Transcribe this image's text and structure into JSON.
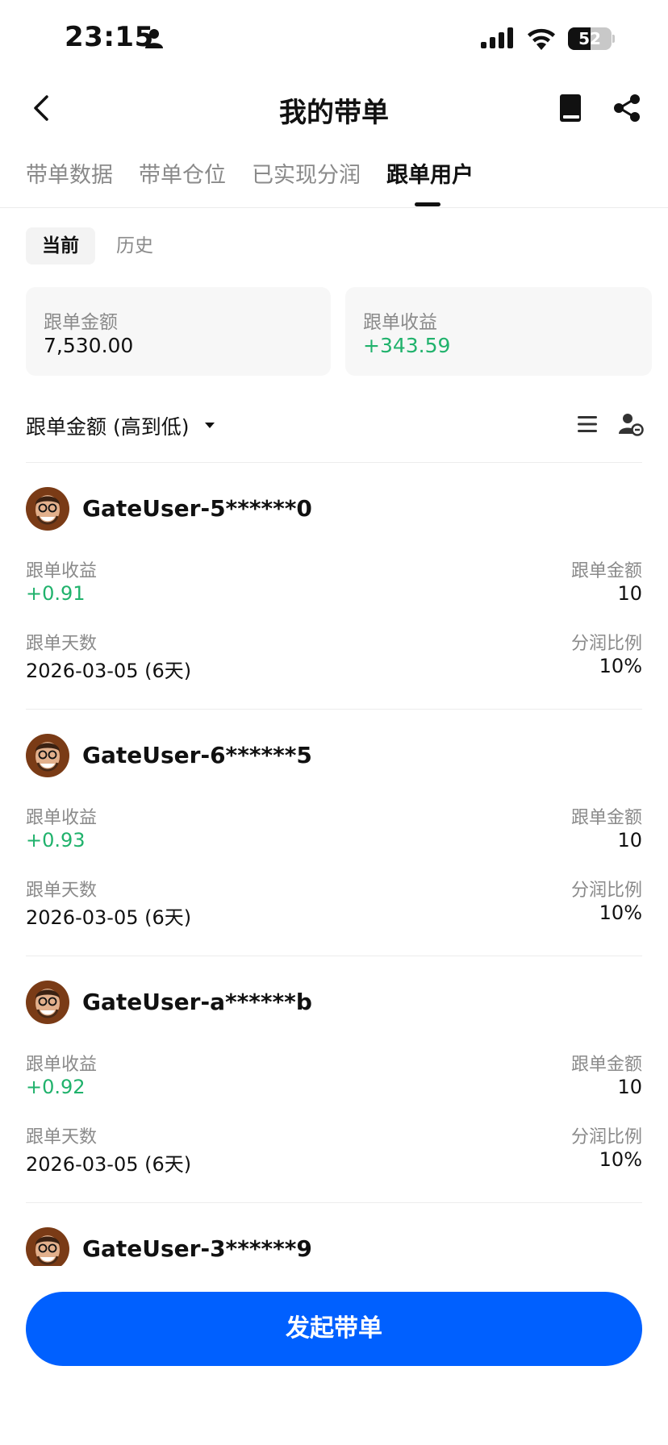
{
  "status_bar": {
    "time": "23:15",
    "battery_text": "52",
    "battery_level_percent": 52,
    "icons": [
      "person-icon",
      "signal-icon",
      "wifi-icon",
      "battery-icon"
    ]
  },
  "header": {
    "title": "我的带单",
    "icons": [
      "back-icon",
      "book-icon",
      "share-icon"
    ]
  },
  "tabs": [
    {
      "label": "带单数据",
      "active": false
    },
    {
      "label": "带单仓位",
      "active": false
    },
    {
      "label": "已实现分润",
      "active": false
    },
    {
      "label": "跟单用户",
      "active": true
    }
  ],
  "subtabs": {
    "current": "当前",
    "history": "历史",
    "selected": "当前"
  },
  "summary": {
    "amount_label": "跟单金额",
    "amount_value": "7,530.00",
    "profit_label": "跟单收益",
    "profit_value": "+343.59"
  },
  "sort": {
    "label": "跟单金额 (高到低)",
    "icons": [
      "list-icon",
      "user-filter-icon"
    ]
  },
  "labels": {
    "profit": "跟单收益",
    "amount": "跟单金额",
    "days": "跟单天数",
    "share_ratio": "分润比例"
  },
  "users": [
    {
      "name": "GateUser-5******0",
      "profit": "+0.91",
      "amount": "10",
      "days": "2026-03-05 (6天)",
      "ratio": "10%"
    },
    {
      "name": "GateUser-6******5",
      "profit": "+0.93",
      "amount": "10",
      "days": "2026-03-05 (6天)",
      "ratio": "10%"
    },
    {
      "name": "GateUser-a******b",
      "profit": "+0.92",
      "amount": "10",
      "days": "2026-03-05 (6天)",
      "ratio": "10%"
    },
    {
      "name": "GateUser-3******9"
    }
  ],
  "bottom_button": {
    "label": "发起带单"
  },
  "colors": {
    "accent_blue": "#0060ff",
    "profit_green": "#20b26c",
    "muted_text": "#8a8a8a"
  }
}
